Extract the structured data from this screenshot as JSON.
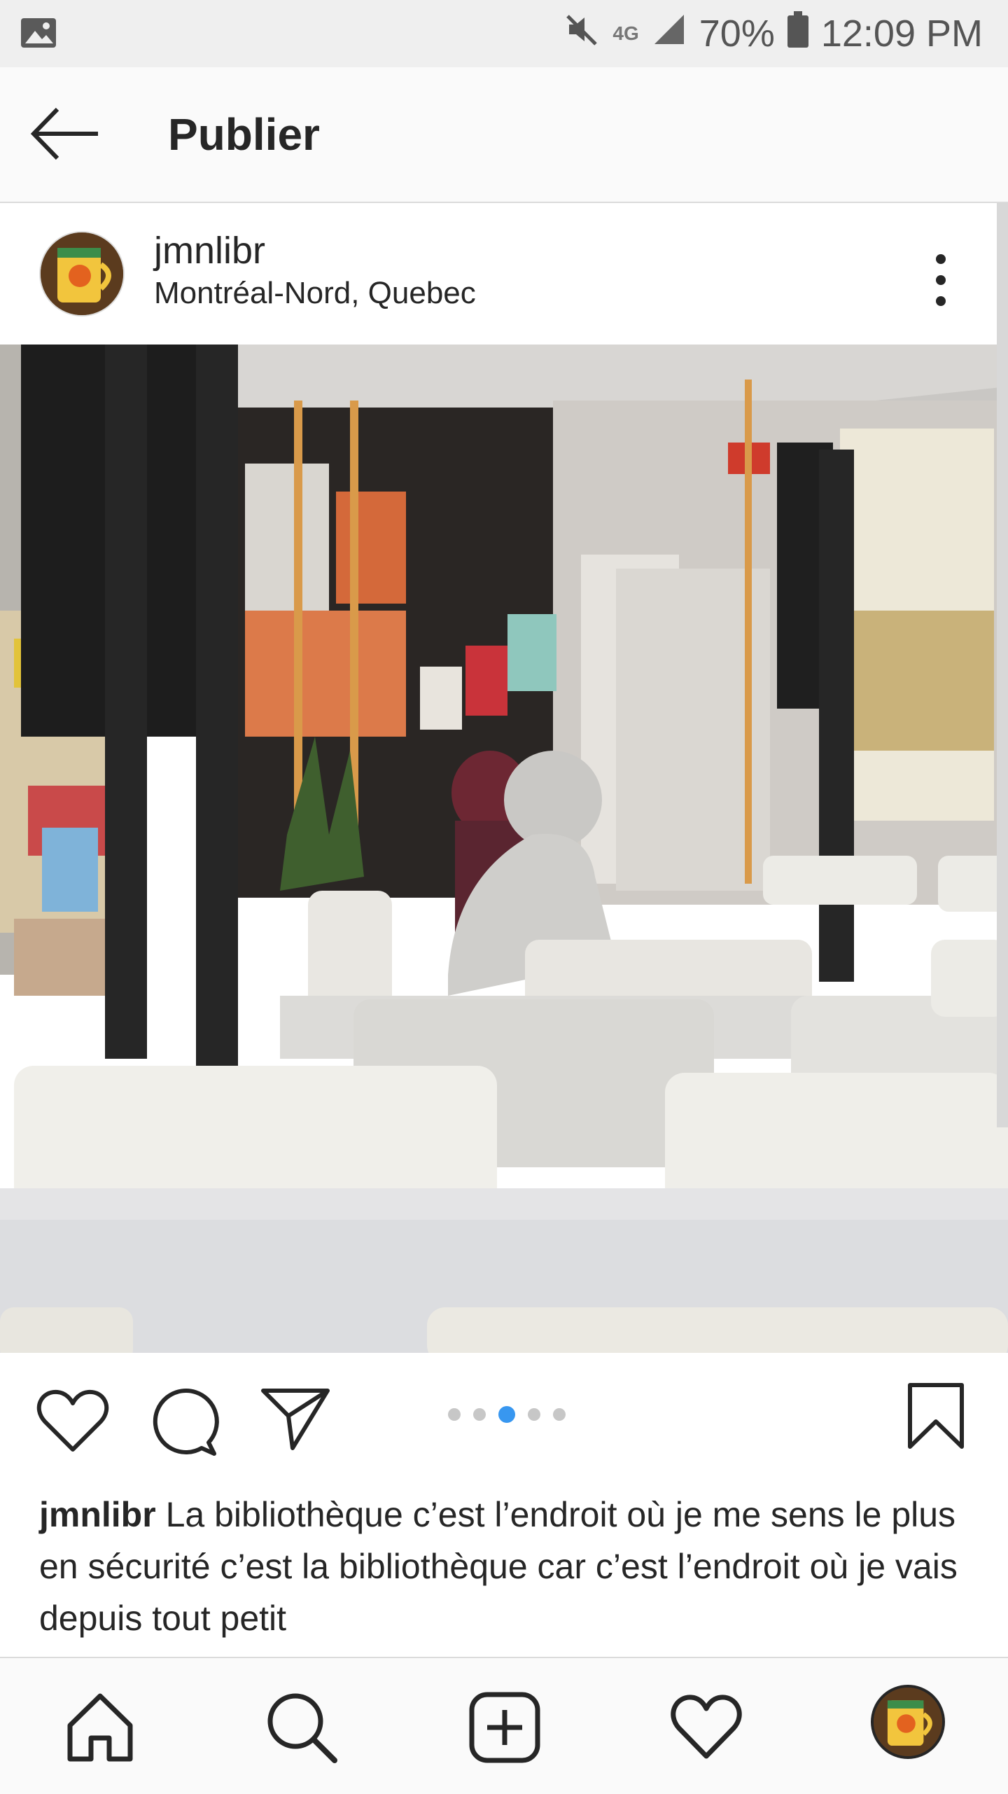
{
  "status_bar": {
    "battery": "70%",
    "time": "12:09 PM",
    "network": "4G"
  },
  "header": {
    "title": "Publier"
  },
  "post": {
    "username": "jmnlibr",
    "location": "Montréal-Nord, Quebec",
    "carousel": {
      "total": 5,
      "active_index": 2
    },
    "caption_user": "jmnlibr",
    "caption_text": "La bibliothèque c’est l’endroit où je me sens le plus en sécurité c’est la bibliothèque car c’est l’endroit où je vais depuis tout petit"
  },
  "colors": {
    "accent_blue": "#3897f0",
    "text": "#262626",
    "divider": "#dbdbdb"
  },
  "icons": {
    "status_left": "image-icon",
    "mute": "mute-icon",
    "signal": "signal-icon",
    "battery": "battery-icon",
    "back": "arrow-left-icon",
    "more": "more-vertical-icon",
    "like": "heart-icon",
    "comment": "comment-icon",
    "share": "send-icon",
    "save": "bookmark-icon",
    "home": "home-icon",
    "search": "search-icon",
    "add": "add-post-icon",
    "activity": "heart-icon",
    "profile": "profile-avatar"
  }
}
